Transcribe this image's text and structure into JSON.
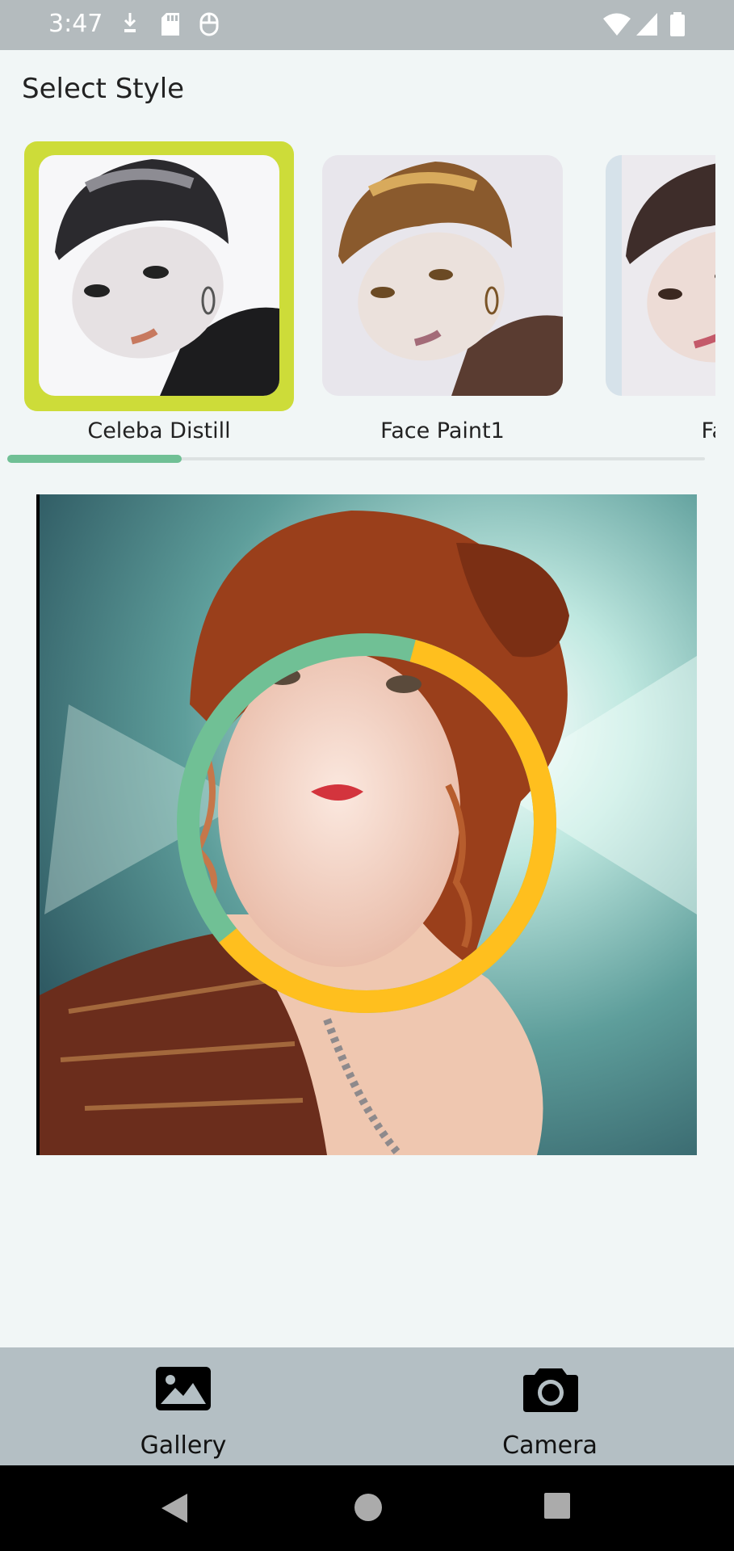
{
  "status_bar": {
    "time": "3:47",
    "left_icons": [
      "download-icon",
      "sd-card-icon",
      "mouse-icon"
    ],
    "right_icons": [
      "wifi-icon",
      "signal-icon",
      "battery-icon"
    ]
  },
  "page": {
    "section_title": "Select Style"
  },
  "styles": [
    {
      "label": "Celeba Distill",
      "selected": true
    },
    {
      "label": "Face Paint1",
      "selected": false
    },
    {
      "label": "Face",
      "selected": false
    }
  ],
  "carousel_scroll_progress": 0.25,
  "loading": {
    "progress": 0.6
  },
  "bottom_nav": {
    "gallery_label": "Gallery",
    "camera_label": "Camera"
  },
  "colors": {
    "accent_selected": "#cddc39",
    "progress_green": "#70c095",
    "ring_yellow": "#ffbf1e",
    "nav_bg": "#b4bfc4"
  }
}
